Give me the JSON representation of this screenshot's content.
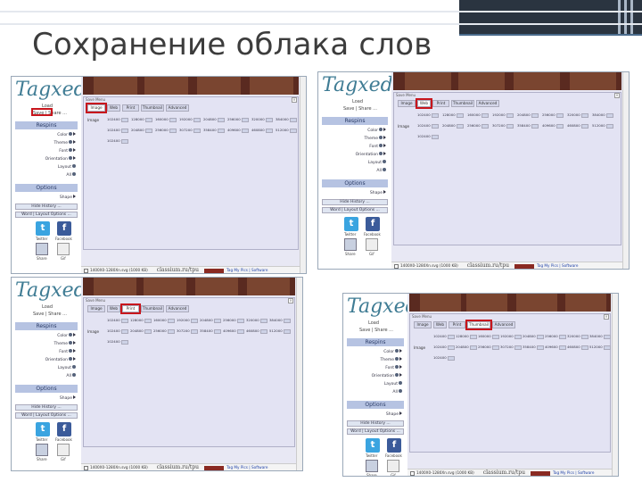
{
  "slide": {
    "title": "Сохранение облака слов"
  },
  "shots": [
    {
      "id": "top-left",
      "highlight_tab": 0,
      "sidebar_highlight": true,
      "dialog_title": "Save Menu",
      "tabs": [
        "Image",
        "Web",
        "Print",
        "Thumbnail",
        "Advanced"
      ],
      "rows": [
        {
          "label": "Image",
          "cells": [
            "1024X0",
            "1280X0",
            "1600X0",
            "1920X0",
            "2048X0",
            "2560X0",
            "3200X0",
            "3840X0"
          ]
        },
        {
          "label": "",
          "cells": [
            "1024X0",
            "2048X0",
            "2560X0",
            "3072X0",
            "3584X0",
            "4096X0",
            "4608X0",
            "5120X0"
          ]
        },
        {
          "label": "",
          "cells": [
            "1024X0"
          ]
        }
      ]
    },
    {
      "id": "top-right",
      "highlight_tab": 1,
      "sidebar_highlight": false,
      "dialog_title": "Save Menu",
      "tabs": [
        "Image",
        "Web",
        "Print",
        "Thumbnail",
        "Advanced"
      ],
      "rows": [
        {
          "label": "",
          "cells": [
            "1024X0",
            "1280X0",
            "1600X0",
            "1920X0",
            "2048X0",
            "2560X0",
            "3200X0",
            "3840X0"
          ]
        },
        {
          "label": "Image",
          "cells": [
            "1024X0",
            "2048X0",
            "2560X0",
            "3072X0",
            "3584X0",
            "4096X0",
            "4608X0",
            "5120X0"
          ]
        },
        {
          "label": "",
          "cells": [
            "1024X0"
          ]
        }
      ]
    },
    {
      "id": "bottom-left",
      "highlight_tab": 2,
      "sidebar_highlight": false,
      "dialog_title": "Save Menu",
      "tabs": [
        "Image",
        "Web",
        "Print",
        "Thumbnail",
        "Advanced"
      ],
      "rows": [
        {
          "label": "",
          "cells": [
            "1024X0",
            "1280X0",
            "1600X0",
            "1920X0",
            "2048X0",
            "2560X0",
            "3200X0",
            "3840X0"
          ]
        },
        {
          "label": "Image",
          "cells": [
            "1024X0",
            "2048X0",
            "2560X0",
            "3072X0",
            "3584X0",
            "4096X0",
            "4608X0",
            "5120X0"
          ]
        },
        {
          "label": "",
          "cells": [
            "1024X0"
          ]
        }
      ]
    },
    {
      "id": "bottom-right",
      "highlight_tab": 3,
      "sidebar_highlight": false,
      "dialog_title": "Save Menu",
      "tabs": [
        "Image",
        "Web",
        "Print",
        "Thumbnail",
        "Advanced"
      ],
      "rows": [
        {
          "label": "",
          "cells": [
            "1024X0",
            "1280X0",
            "1600X0",
            "1920X0",
            "2048X0",
            "2560X0",
            "3200X0",
            "3840X0"
          ]
        },
        {
          "label": "Image",
          "cells": [
            "1024X0",
            "2048X0",
            "2560X0",
            "3072X0",
            "3584X0",
            "4096X0",
            "4608X0",
            "5120X0"
          ]
        },
        {
          "label": "",
          "cells": [
            "1024X0"
          ]
        }
      ]
    }
  ],
  "sidebar": {
    "logo": "Tagxedo",
    "save_links": [
      "Load",
      "Save | Share ..."
    ],
    "respins_label": "Respins",
    "items": [
      "Color",
      "Theme",
      "Font",
      "Orientation",
      "Layout",
      "All"
    ],
    "options_label": "Options",
    "shape_label": "Shape",
    "buttons": [
      "Hide History ...",
      "Word | Layout Options ..."
    ],
    "social": {
      "twitter": "Twitter",
      "facebook": "Facebook",
      "share": "Share",
      "gif": "Gif"
    }
  },
  "status_bar": {
    "text": "1400X0-1280Xn.svg (1000 KB)",
    "brand": "classium.ru/tpu",
    "link": "Tag My Pics | Software"
  },
  "colors": {
    "accent_highlight": "#c8161d",
    "sidebar_header": "#b6c3e2",
    "dialog_bg": "#e3e3f3",
    "logo": "#3f7c94",
    "twitter": "#3aa4e0",
    "facebook": "#3b5b9a"
  },
  "icons": {
    "twitter": "twitter-icon",
    "facebook": "facebook-icon",
    "share": "share-icon",
    "gif": "gif-icon"
  }
}
